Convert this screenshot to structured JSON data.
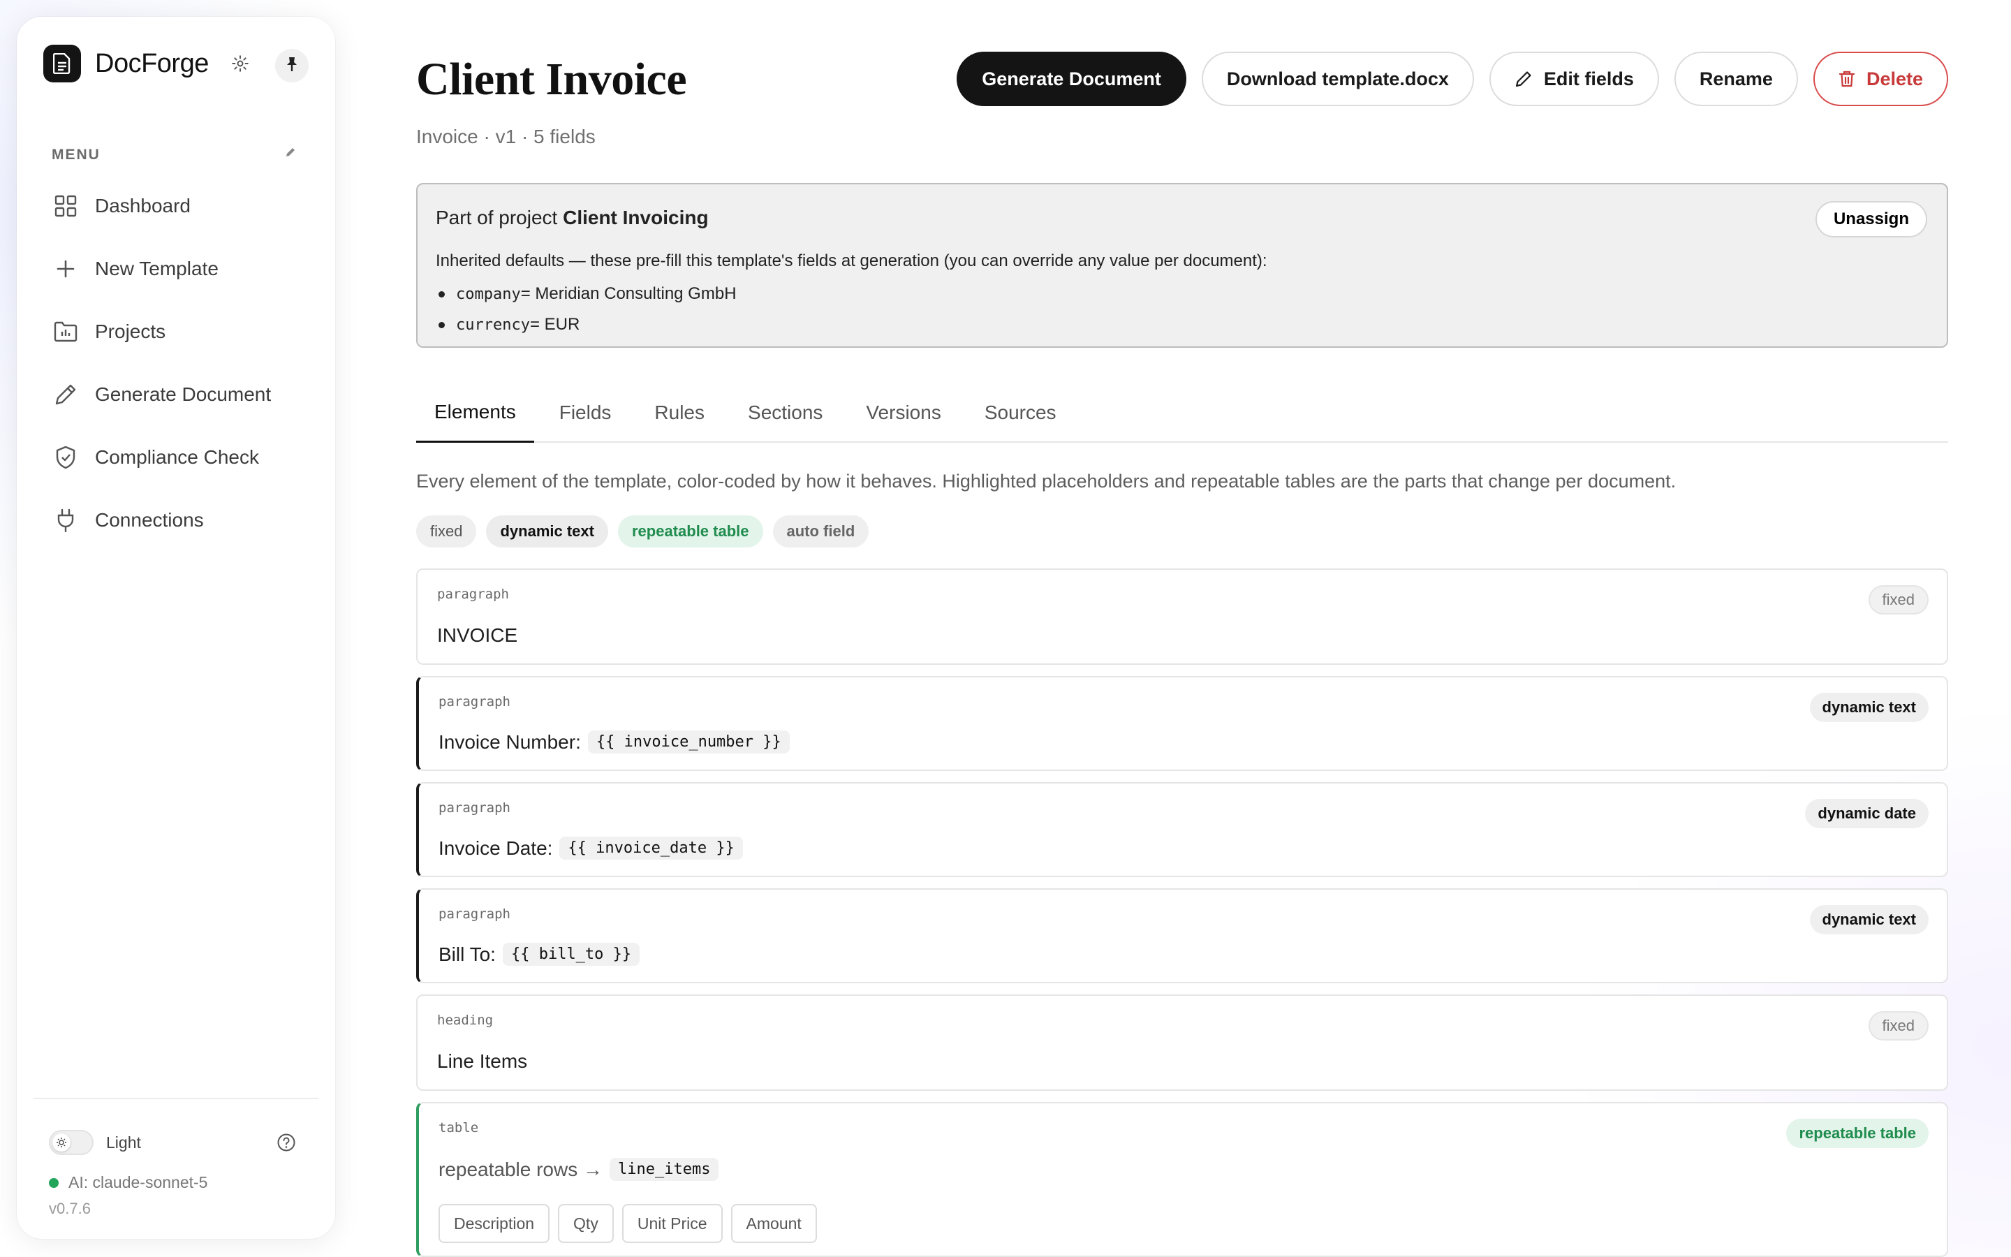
{
  "app": {
    "name": "DocForge",
    "menu_label": "MENU",
    "nav": [
      {
        "label": "Dashboard",
        "icon": "grid-icon"
      },
      {
        "label": "New Template",
        "icon": "plus-icon"
      },
      {
        "label": "Projects",
        "icon": "folder-icon"
      },
      {
        "label": "Generate Document",
        "icon": "pen-icon"
      },
      {
        "label": "Compliance Check",
        "icon": "shield-icon"
      },
      {
        "label": "Connections",
        "icon": "plug-icon"
      }
    ],
    "theme_label": "Light",
    "ai_status": "AI: claude-sonnet-5",
    "version": "v0.7.6",
    "status_color": "#22a55a"
  },
  "page": {
    "title": "Client Invoice",
    "subtitle": "Invoice · v1 · 5 fields",
    "actions": {
      "generate": "Generate Document",
      "download": "Download template.docx",
      "edit": "Edit fields",
      "rename": "Rename",
      "delete": "Delete"
    }
  },
  "project": {
    "prefix": "Part of project ",
    "name": "Client Invoicing",
    "unassign": "Unassign",
    "inherit_text": "Inherited defaults — these pre-fill this template's fields at generation (you can override any value per document):",
    "defaults": [
      {
        "key": "company",
        "value": " = Meridian Consulting GmbH"
      },
      {
        "key": "currency",
        "value": " = EUR"
      }
    ]
  },
  "tabs": [
    "Elements",
    "Fields",
    "Rules",
    "Sections",
    "Versions",
    "Sources"
  ],
  "active_tab": "Elements",
  "elements_desc": "Every element of the template, color-coded by how it behaves. Highlighted placeholders and repeatable tables are the parts that change per document.",
  "legend": [
    "fixed",
    "dynamic text",
    "repeatable table",
    "auto field"
  ],
  "elements": [
    {
      "type": "paragraph",
      "badge": "fixed",
      "text": "INVOICE"
    },
    {
      "type": "paragraph",
      "badge": "dynamic text",
      "text": "Invoice Number:",
      "placeholder": "{{ invoice_number }}"
    },
    {
      "type": "paragraph",
      "badge": "dynamic date",
      "text": "Invoice Date:",
      "placeholder": "{{ invoice_date }}"
    },
    {
      "type": "paragraph",
      "badge": "dynamic text",
      "text": "Bill To:",
      "placeholder": "{{ bill_to }}"
    },
    {
      "type": "heading",
      "badge": "fixed",
      "text": "Line Items"
    },
    {
      "type": "table",
      "badge": "repeatable table",
      "text": "repeatable rows →",
      "placeholder": "line_items",
      "columns": [
        "Description",
        "Qty",
        "Unit Price",
        "Amount"
      ]
    }
  ],
  "colors": {
    "primary": "#141414",
    "danger": "#c83a3a",
    "repeatable": "#1f8c4e"
  }
}
